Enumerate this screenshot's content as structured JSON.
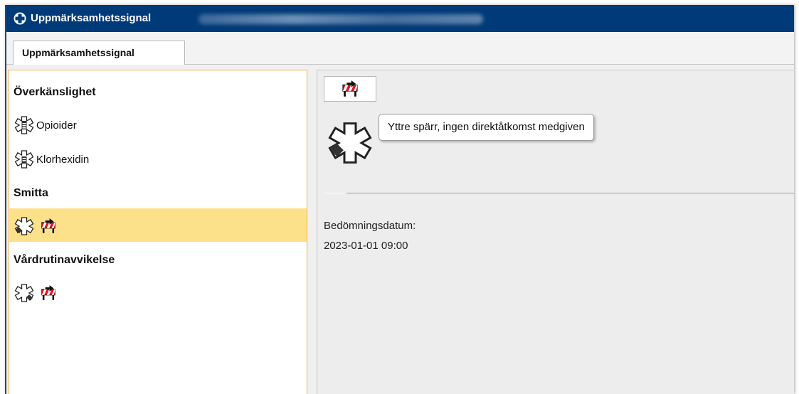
{
  "window": {
    "title": "Uppmärksamhetssignal"
  },
  "tabs": [
    {
      "label": "Uppmärksamhetssignal"
    }
  ],
  "left_panel": {
    "groups": [
      {
        "header": "Överkänslighet",
        "items": [
          {
            "label": "Opioider",
            "icon": "pill-star-icon"
          },
          {
            "label": "Klorhexidin",
            "icon": "pill-star-icon"
          }
        ]
      },
      {
        "header": "Smitta",
        "items": [
          {
            "label": "",
            "icon": "star-of-life-icon",
            "badge": "barrier-icon",
            "selected": true
          }
        ]
      },
      {
        "header": "Vårdrutinavvikelse",
        "items": [
          {
            "label": "",
            "icon": "star-of-life-icon",
            "badge": "barrier-icon"
          }
        ]
      }
    ]
  },
  "detail": {
    "tooltip": "Yttre spärr, ingen direktåtkomst medgiven",
    "date_label": "Bedömningsdatum:",
    "date_value": "2023-01-01 09:00"
  },
  "colors": {
    "title_bar": "#003a78",
    "selection": "#fde08a",
    "panel_border": "#f0b35a",
    "barrier_red": "#e8101c"
  }
}
